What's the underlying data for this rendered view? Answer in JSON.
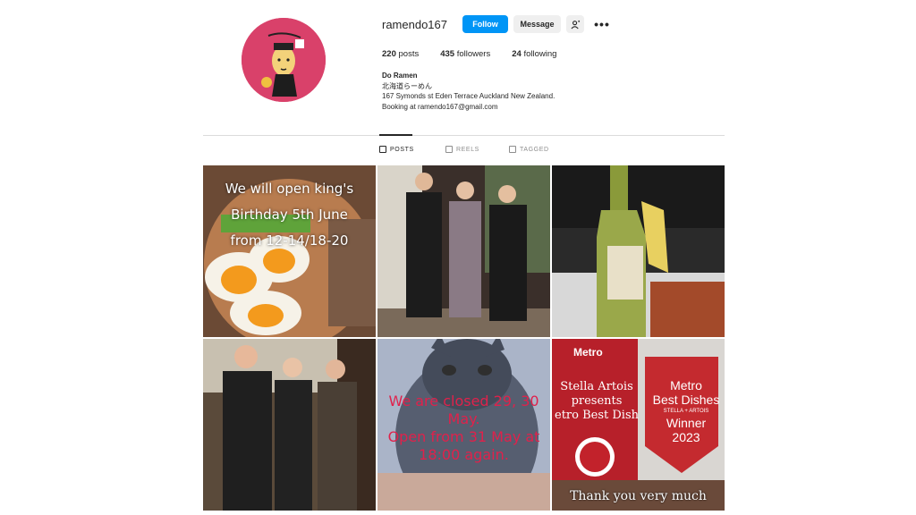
{
  "profile": {
    "username": "ramendo167",
    "follow_label": "Follow",
    "message_label": "Message",
    "suggest_icon": "add-person-icon",
    "more_label": "•••"
  },
  "stats": {
    "posts_count": "220",
    "posts_label": "posts",
    "followers_count": "435",
    "followers_label": "followers",
    "following_count": "24",
    "following_label": "following"
  },
  "bio": {
    "name": "Do Ramen",
    "line1": "北海道らーめん",
    "line2": "167 Symonds st Eden Terrace Auckland New Zealand.",
    "line3": "Booking at ramendo167@gmail.com"
  },
  "tabs": [
    {
      "label": "POSTS",
      "icon": "grid-icon"
    },
    {
      "label": "REELS",
      "icon": "reels-icon"
    },
    {
      "label": "TAGGED",
      "icon": "tagged-icon"
    }
  ],
  "posts": [
    {
      "text_l1": "We will open king's",
      "text_l2": "Birthday 5th June",
      "text_l3": "from 12-14/18-20"
    },
    {
      "text": ""
    },
    {
      "text": ""
    },
    {
      "text": ""
    },
    {
      "text_l1": "We are closed 29, 30",
      "text_l2": "May.",
      "text_l3": "Open from 31 May at",
      "text_l4": "18:00 again."
    },
    {
      "metro": "Metro",
      "stella_l1": "Stella Artois",
      "stella_l2": "presents",
      "stella_l3": "etro Best Dish",
      "badge_l1": "Metro",
      "badge_l2": "Best Dishes",
      "badge_l3": "STELLA + ARTOIS",
      "badge_l4": "Winner",
      "badge_l5": "2023",
      "thanks": "Thank you very much"
    }
  ],
  "colors": {
    "accent": "#0095f6",
    "avatar_bg": "#d9416a",
    "text": "#262626",
    "muted": "#8e8e8e"
  }
}
